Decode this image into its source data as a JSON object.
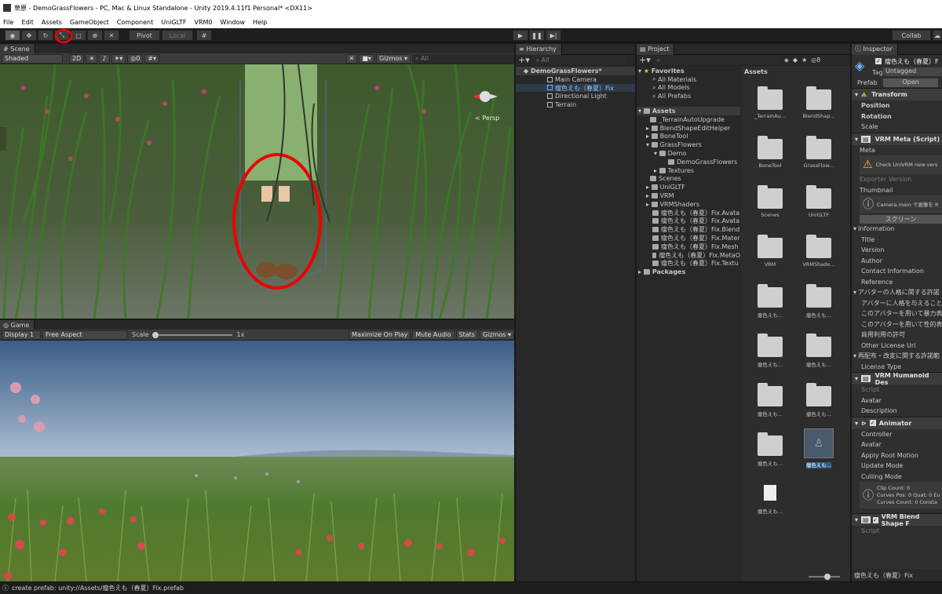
{
  "window": {
    "title": "草原 - DemoGrassFlowers - PC, Mac & Linux Standalone - Unity 2019.4.11f1 Personal* <DX11>"
  },
  "menu": [
    "File",
    "Edit",
    "Assets",
    "GameObject",
    "Component",
    "UniGLTF",
    "VRM0",
    "Window",
    "Help"
  ],
  "toolbar": {
    "pivot": "Pivot",
    "local": "Local",
    "collab": "Collab"
  },
  "scene": {
    "tab": "Scene",
    "shading": "Shaded",
    "mode2d": "2D",
    "hidden_count": "0",
    "gizmos": "Gizmos",
    "search": "All",
    "persp": "< Persp"
  },
  "game": {
    "tab": "Game",
    "display": "Display 1",
    "aspect": "Free Aspect",
    "scale_label": "Scale",
    "scale_value": "1x",
    "maximize": "Maximize On Play",
    "mute": "Mute Audio",
    "stats": "Stats",
    "gizmos": "Gizmos"
  },
  "hierarchy": {
    "tab": "Hierarchy",
    "search": "All",
    "scene": "DemoGrassFlowers*",
    "items": [
      "Main Camera",
      "瘤色えも（春夏）Fix",
      "Directional Light",
      "Terrain"
    ]
  },
  "project": {
    "tab": "Project",
    "favorites": "Favorites",
    "favorite_items": [
      "All Materials",
      "All Models",
      "All Prefabs"
    ],
    "assets_root": "Assets",
    "tree": [
      "_TerrainAutoUpgrade",
      "BlendShapeEditHelper",
      "BoneTool",
      "GrassFlowers",
      "Demo",
      "DemoGrassFlowers",
      "Textures",
      "Scenes",
      "UniGLTF",
      "VRM",
      "VRMShaders",
      "瘤色えも（春夏）Fix.Avata",
      "瘤色えも（春夏）Fix.Avata",
      "瘤色えも（春夏）Fix.Blend",
      "瘤色えも（春夏）Fix.Mater",
      "瘤色えも（春夏）Fix.Mesh",
      "瘤色えも（春夏）Fix.MetaO",
      "瘤色えも（春夏）Fix.Textu"
    ],
    "packages": "Packages",
    "grid_title": "Assets",
    "grid": [
      "_TerrainAu...",
      "BlendShap...",
      "BoneTool",
      "GrassFlow...",
      "Scenes",
      "UniGLTF",
      "VRM",
      "VRMShade...",
      "瘤色えも...",
      "瘤色えも...",
      "瘤色えも...",
      "瘤色えも...",
      "瘤色えも...",
      "瘤色えも...",
      "瘤色えも...",
      "瘤色えも...",
      "瘤色えも..."
    ],
    "badge": "8"
  },
  "inspector": {
    "tab": "Inspector",
    "name": "瘤色えも（春夏）F",
    "tag_label": "Tag",
    "tag_value": "Untagged",
    "prefab_label": "Prefab",
    "prefab_open": "Open",
    "transform": "Transform",
    "transform_rows": [
      "Position",
      "Rotation",
      "Scale"
    ],
    "vrm_meta": "VRM Meta (Script)",
    "meta_label": "Meta",
    "meta_warning": "Check UniVRM new vers",
    "exporter": "Exporter Version",
    "thumbnail": "Thumbnail",
    "thumb_msg": "Camera.main で画像を R",
    "screenshot_btn": "スクリーン",
    "info_rows": [
      "Information",
      "Title",
      "Version",
      "Author",
      "Contact Information",
      "Reference",
      "アバターの人格に関する許諾",
      "アバターに人格を与えること",
      "このアバターを用いて暴力表",
      "このアバターを用いて性的表",
      "商用利用の許可",
      "Other License Url",
      "再配布・改変に関する許諾範",
      "License Type"
    ],
    "humanoid": "VRM Humanoid Des",
    "humanoid_rows": [
      "Script",
      "Avatar",
      "Description"
    ],
    "animator": "Animator",
    "animator_rows": [
      "Controller",
      "Avatar",
      "Apply Root Motion",
      "Update Mode",
      "Culling Mode"
    ],
    "anim_info": [
      "Clip Count: 0",
      "Curves Pos: 0 Quat: 0 Eu",
      "Curves Count: 0 Consta"
    ],
    "blendshape": "VRM Blend Shape F",
    "blend_rows": [
      "Script"
    ],
    "footer": "瘤色えも（春夏）Fix"
  },
  "status": "create prefab: unity://Assets/瘤色えも（春夏）Fix.prefab"
}
